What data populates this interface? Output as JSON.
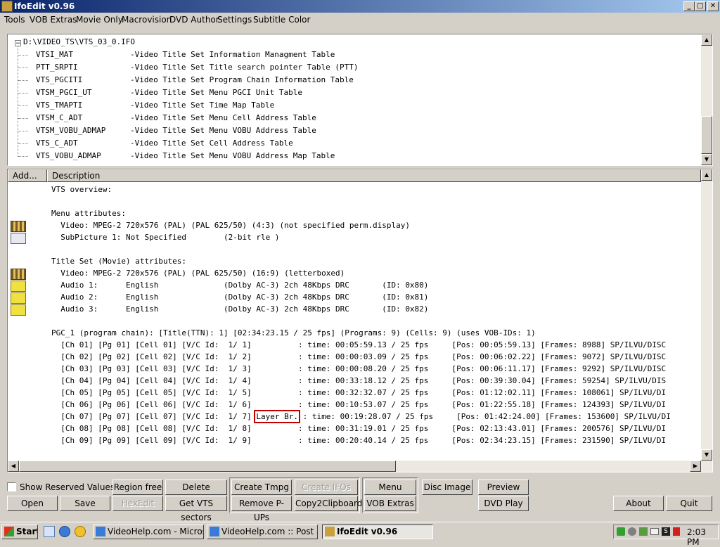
{
  "window": {
    "title": "IfoEdit v0.96"
  },
  "menu": [
    "Tools",
    "VOB Extras",
    "Movie Only",
    "Macrovision",
    "DVD Author",
    "Settings",
    "Subtitle Color"
  ],
  "tree": {
    "root": "D:\\VIDEO_TS\\VTS_03_0.IFO",
    "items": [
      {
        "name": "VTSI_MAT",
        "desc": "-Video Title Set Information Managment Table"
      },
      {
        "name": "PTT_SRPTI",
        "desc": "-Video Title Set Title search pointer Table (PTT)"
      },
      {
        "name": "VTS_PGCITI",
        "desc": "-Video Title Set Program Chain Information Table"
      },
      {
        "name": "VTSM_PGCI_UT",
        "desc": "-Video Title Set Menu PGCI Unit Table"
      },
      {
        "name": "VTS_TMAPTI",
        "desc": "-Video Title Set Time Map Table"
      },
      {
        "name": "VTSM_C_ADT",
        "desc": "-Video Title Set Menu Cell Address Table"
      },
      {
        "name": "VTSM_VOBU_ADMAP",
        "desc": "-Video Title Set Menu VOBU Address Table"
      },
      {
        "name": "VTS_C_ADT",
        "desc": "-Video Title Set Cell Address Table"
      },
      {
        "name": "VTS_VOBU_ADMAP",
        "desc": "-Video Title Set Menu VOBU Address Map Table"
      }
    ]
  },
  "details": {
    "col_add": "Add...",
    "col_desc": "Description",
    "lines": [
      {
        "text": "VTS overview:",
        "icon": ""
      },
      {
        "text": "",
        "icon": ""
      },
      {
        "text": "Menu attributes:",
        "icon": ""
      },
      {
        "text": "  Video: MPEG-2 720x576 (PAL) (PAL 625/50) (4:3) (not specified perm.display)",
        "icon": "video-icon"
      },
      {
        "text": "  SubPicture 1: Not Specified        (2-bit rle )",
        "icon": "subpicture-icon"
      },
      {
        "text": "",
        "icon": ""
      },
      {
        "text": "Title Set (Movie) attributes:",
        "icon": ""
      },
      {
        "text": "  Video: MPEG-2 720x576 (PAL) (PAL 625/50) (16:9) (letterboxed)",
        "icon": "video-icon"
      },
      {
        "text": "  Audio 1:      English              (Dolby AC-3) 2ch 48Kbps DRC       (ID: 0x80)",
        "icon": "audio-icon"
      },
      {
        "text": "  Audio 2:      English              (Dolby AC-3) 2ch 48Kbps DRC       (ID: 0x81)",
        "icon": "audio-icon"
      },
      {
        "text": "  Audio 3:      English              (Dolby AC-3) 2ch 48Kbps DRC       (ID: 0x82)",
        "icon": "audio-icon"
      },
      {
        "text": "",
        "icon": ""
      },
      {
        "text": "PGC_1 (program chain): [Title(TTN): 1] [02:34:23.15 / 25 fps] (Programs: 9) (Cells: 9) (uses VOB-IDs: 1)",
        "icon": ""
      },
      {
        "text": "  [Ch 01] [Pg 01] [Cell 01] [V/C Id:  1/ 1]          : time: 00:05:59.13 / 25 fps     [Pos: 00:05:59.13] [Frames: 8988] SP/ILVU/DISC",
        "icon": ""
      },
      {
        "text": "  [Ch 02] [Pg 02] [Cell 02] [V/C Id:  1/ 2]          : time: 00:00:03.09 / 25 fps     [Pos: 00:06:02.22] [Frames: 9072] SP/ILVU/DISC",
        "icon": ""
      },
      {
        "text": "  [Ch 03] [Pg 03] [Cell 03] [V/C Id:  1/ 3]          : time: 00:00:08.20 / 25 fps     [Pos: 00:06:11.17] [Frames: 9292] SP/ILVU/DISC",
        "icon": ""
      },
      {
        "text": "  [Ch 04] [Pg 04] [Cell 04] [V/C Id:  1/ 4]          : time: 00:33:18.12 / 25 fps     [Pos: 00:39:30.04] [Frames: 59254] SP/ILVU/DIS",
        "icon": ""
      },
      {
        "text": "  [Ch 05] [Pg 05] [Cell 05] [V/C Id:  1/ 5]          : time: 00:32:32.07 / 25 fps     [Pos: 01:12:02.11] [Frames: 108061] SP/ILVU/DI",
        "icon": ""
      },
      {
        "text": "  [Ch 06] [Pg 06] [Cell 06] [V/C Id:  1/ 6]          : time: 00:10:53.07 / 25 fps     [Pos: 01:22:55.18] [Frames: 124393] SP/ILVU/DI",
        "icon": ""
      },
      {
        "text": "  [Ch 07] [Pg 07] [Cell 07] [V/C Id:  1/ 7] Layer Br. : time: 00:19:28.07 / 25 fps     [Pos: 01:42:24.00] [Frames: 153600] SP/ILVU/DI",
        "icon": ""
      },
      {
        "text": "  [Ch 08] [Pg 08] [Cell 08] [V/C Id:  1/ 8]          : time: 00:31:19.01 / 25 fps     [Pos: 02:13:43.01] [Frames: 200576] SP/ILVU/DI",
        "icon": ""
      },
      {
        "text": "  [Ch 09] [Pg 09] [Cell 09] [V/C Id:  1/ 9]          : time: 00:20:40.14 / 25 fps     [Pos: 02:34:23.15] [Frames: 231590] SP/ILVU/DI",
        "icon": ""
      }
    ],
    "highlight": "Layer Br."
  },
  "controls": {
    "show_reserved": "Show Reserved Values",
    "open": "Open",
    "save": "Save",
    "region_free": "Region free",
    "hexedit": "HexEdit",
    "delete_playback": "Delete Playback",
    "get_vts_sectors": "Get VTS sectors",
    "create_tmpg": "Create Tmpg T.",
    "remove_pups": "Remove P-UPs",
    "create_ifos": "Create IFOs",
    "copy2clipboard": "Copy2Clipboard",
    "menu_extras": "Menu Extras",
    "vob_extras": "VOB Extras",
    "disc_image": "Disc Image",
    "preview": "Preview",
    "dvd_play": "DVD Play",
    "about": "About",
    "quit": "Quit"
  },
  "taskbar": {
    "start": "Start",
    "tasks": [
      "VideoHelp.com - Microsof...",
      "VideoHelp.com :: Post a ...",
      "IfoEdit v0.96"
    ],
    "clock": "2:03 PM"
  },
  "colors": {
    "title_start": "#0a246a",
    "title_end": "#a6caf0",
    "highlight_border": "#c00000"
  }
}
